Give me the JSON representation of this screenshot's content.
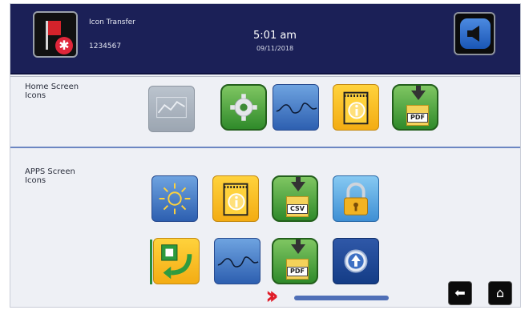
{
  "header": {
    "app_name": "Icon Transfer",
    "app_id": "1234567",
    "time": "5:01 am",
    "date": "09/11/2018"
  },
  "sections": {
    "home_label": "Home Screen\nIcons",
    "apps_label": "APPS Screen\nIcons"
  },
  "icons": {
    "home": [
      "graph-icon",
      "gear-icon",
      "wave-icon",
      "info-notepad-icon",
      "pdf-download-icon"
    ],
    "apps_row1": [
      "brightness-icon",
      "info-notepad-icon",
      "csv-download-icon",
      "lock-icon"
    ],
    "apps_row2": [
      "transfer-icon",
      "wave-icon",
      "pdf-download-icon",
      "upload-icon"
    ]
  },
  "file_tags": {
    "pdf": "PDF",
    "csv": "CSV"
  },
  "colors": {
    "header_bg": "#1b2057",
    "accent_red": "#e01c28",
    "scroll_blue": "#4f6fb7"
  }
}
